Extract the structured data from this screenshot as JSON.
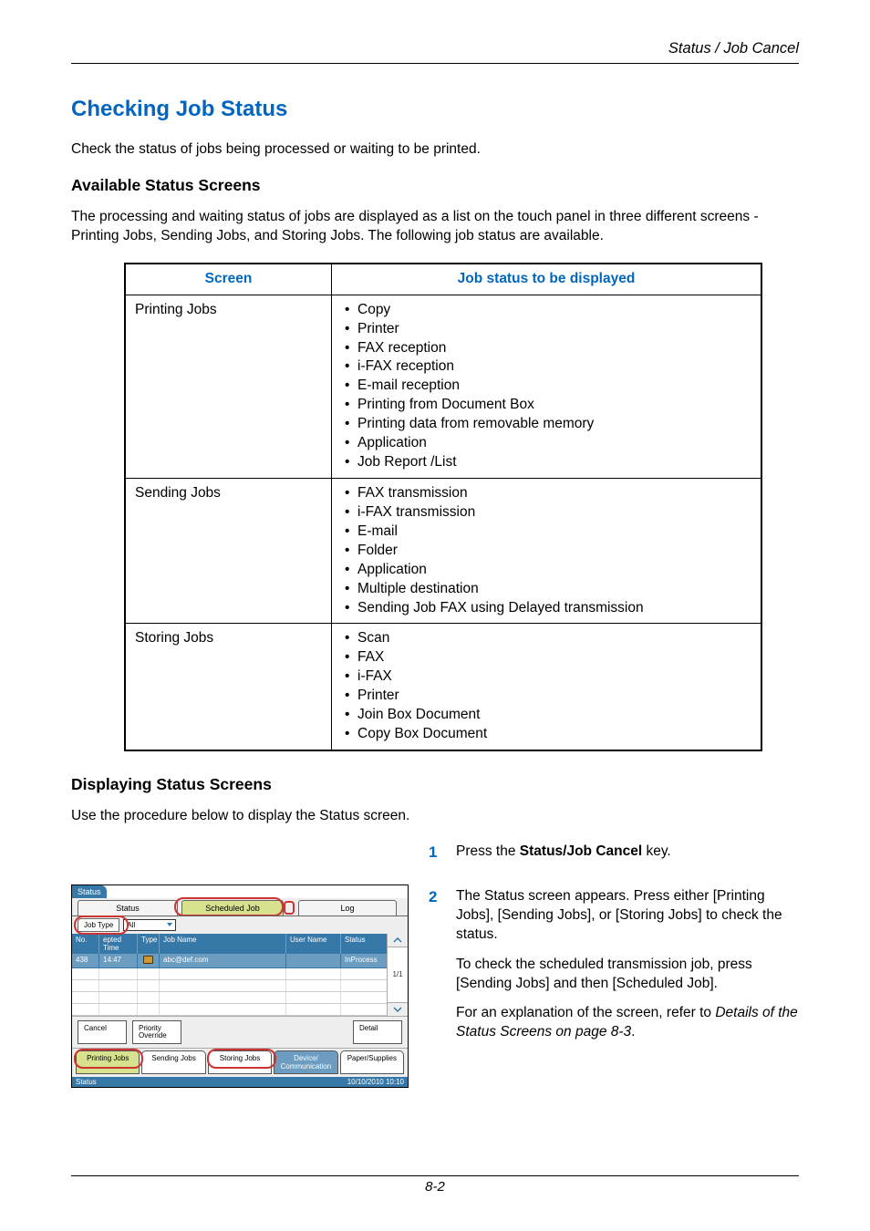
{
  "header": {
    "breadcrumb": "Status / Job Cancel"
  },
  "h1": "Checking Job Status",
  "intro": "Check the status of jobs being processed or waiting to be printed.",
  "h2a": "Available Status Screens",
  "para_a": "The processing and waiting status of jobs are displayed as a list on the touch panel in three different screens - Printing Jobs, Sending Jobs, and Storing Jobs. The following job status are available.",
  "table": {
    "head_screen": "Screen",
    "head_status": "Job status to be displayed",
    "rows": [
      {
        "screen": "Printing Jobs",
        "items": [
          "Copy",
          "Printer",
          "FAX reception",
          "i-FAX reception",
          "E-mail reception",
          "Printing from Document Box",
          "Printing data from removable memory",
          "Application",
          "Job Report /List"
        ]
      },
      {
        "screen": "Sending Jobs",
        "items": [
          "FAX transmission",
          "i-FAX transmission",
          "E-mail",
          "Folder",
          "Application",
          "Multiple destination",
          "Sending Job FAX using Delayed transmission"
        ]
      },
      {
        "screen": "Storing Jobs",
        "items": [
          "Scan",
          "FAX",
          "i-FAX",
          "Printer",
          "Join Box Document",
          "Copy Box Document"
        ]
      }
    ]
  },
  "h2b": "Displaying Status Screens",
  "para_b": "Use the procedure below to display the Status screen.",
  "steps": {
    "s1_pre": "Press the ",
    "s1_bold": "Status/Job Cancel",
    "s1_post": " key.",
    "s2_a": "The Status screen appears. Press either [Printing Jobs], [Sending Jobs], or [Storing Jobs] to check the status.",
    "s2_b": "To check the scheduled transmission job, press [Sending Jobs] and then [Scheduled Job].",
    "s2_c_pre": "For an explanation of the screen, refer to ",
    "s2_c_italic": "Details of the Status Screens on page 8-3",
    "s2_c_post": "."
  },
  "ui": {
    "title": "Status",
    "tab_status": "Status",
    "tab_sched": "Scheduled Job",
    "tab_log": "Log",
    "sub_jobtype": "Job Type",
    "dd_all": "All",
    "hdr": {
      "no": "No.",
      "time": "epted Time",
      "type": "Type",
      "name": "Job Name",
      "user": "User Name",
      "status": "Status"
    },
    "row": {
      "no": "438",
      "time": "14:47",
      "name": "abc@def.com",
      "status": "InProcess"
    },
    "pager": "1/1",
    "btn_cancel": "Cancel",
    "btn_priority": "Priority Override",
    "btn_detail": "Detail",
    "btab_print": "Printing Jobs",
    "btab_send": "Sending Jobs",
    "btab_store": "Storing Jobs",
    "btab_dev": "Device/ Communication",
    "btab_paper": "Paper/Supplies",
    "statusbar_left": "Status",
    "statusbar_right": "10/10/2010  10:10"
  },
  "footer": "8-2"
}
